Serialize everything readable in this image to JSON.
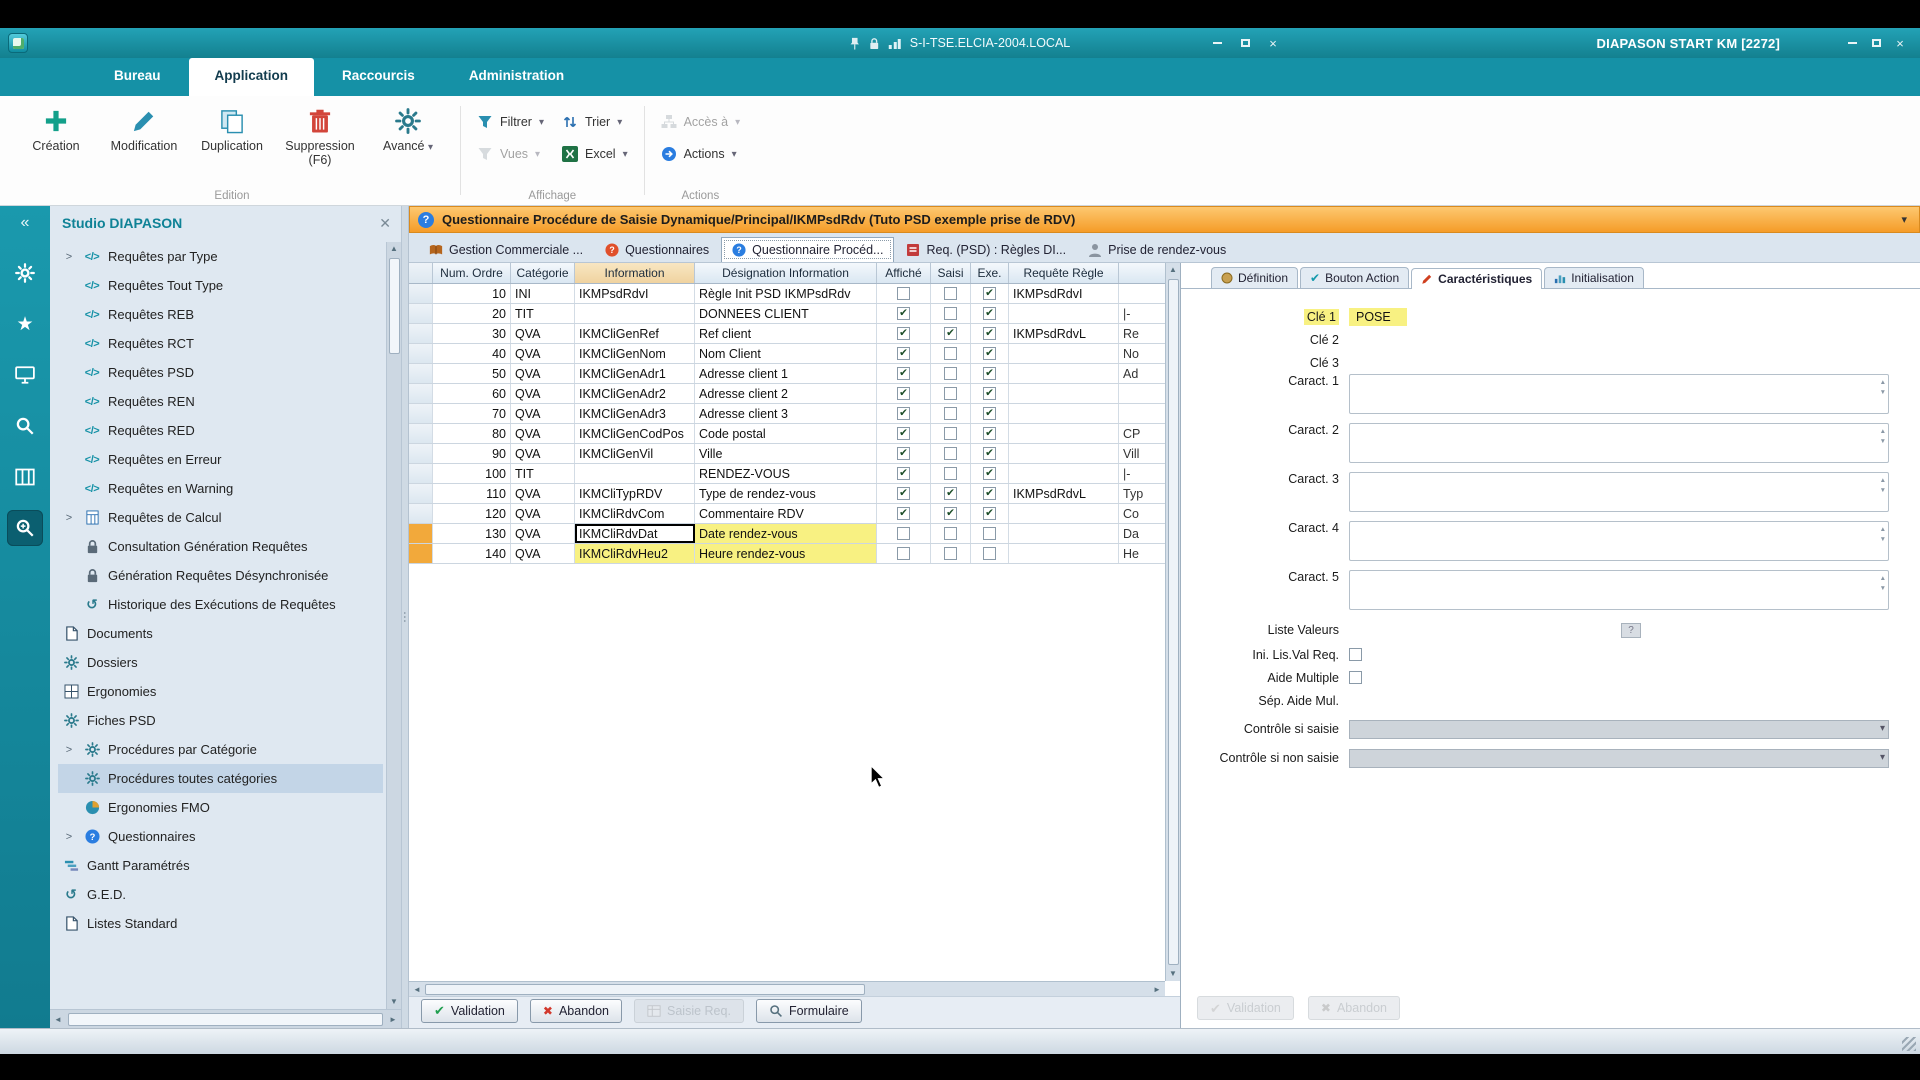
{
  "titlebar": {
    "host": "S-I-TSE.ELCIA-2004.LOCAL",
    "app_title": "DIAPASON START KM [2272]"
  },
  "ribbon": {
    "tabs": [
      {
        "label": "Bureau"
      },
      {
        "label": "Application",
        "active": true
      },
      {
        "label": "Raccourcis"
      },
      {
        "label": "Administration"
      }
    ],
    "edition_buttons": [
      {
        "label": "Création",
        "icon": "plus-icon"
      },
      {
        "label": "Modification",
        "icon": "pencil-icon"
      },
      {
        "label": "Duplication",
        "icon": "copy-icon"
      },
      {
        "label": "Suppression (F6)",
        "icon": "trash-icon"
      },
      {
        "label": "Avancé",
        "icon": "gear-icon",
        "dropdown": true
      }
    ],
    "affichage_buttons": [
      {
        "label": "Filtrer",
        "icon": "filter-icon",
        "dropdown": true
      },
      {
        "label": "Vues",
        "icon": "views-icon",
        "dropdown": true,
        "disabled": true
      },
      {
        "label": "Trier",
        "icon": "sort-icon",
        "dropdown": true
      },
      {
        "label": "Excel",
        "icon": "excel-icon",
        "dropdown": true
      }
    ],
    "actions_buttons": [
      {
        "label": "Accès à",
        "icon": "access-icon",
        "dropdown": true,
        "disabled": true
      },
      {
        "label": "Actions",
        "icon": "actions-icon",
        "dropdown": true
      }
    ],
    "group_labels": [
      "Edition",
      "Affichage",
      "Actions"
    ]
  },
  "rail": {
    "collapse": "«",
    "icons": [
      {
        "name": "gear"
      },
      {
        "name": "star"
      },
      {
        "name": "monitor"
      },
      {
        "name": "search"
      },
      {
        "name": "columns"
      },
      {
        "name": "zoom",
        "active": true
      }
    ]
  },
  "sidebar": {
    "title": "Studio DIAPASON",
    "items": [
      {
        "label": "Requêtes par Type",
        "icon": "code",
        "expand": true
      },
      {
        "label": "Requêtes Tout Type",
        "icon": "code",
        "indent": true
      },
      {
        "label": "Requêtes REB",
        "icon": "code",
        "indent": true
      },
      {
        "label": "Requêtes RCT",
        "icon": "code",
        "indent": true
      },
      {
        "label": "Requêtes PSD",
        "icon": "code",
        "indent": true
      },
      {
        "label": "Requêtes REN",
        "icon": "code",
        "indent": true
      },
      {
        "label": "Requêtes RED",
        "icon": "code",
        "indent": true
      },
      {
        "label": "Requêtes en Erreur",
        "icon": "code",
        "indent": true
      },
      {
        "label": "Requêtes en Warning",
        "icon": "code",
        "indent": true
      },
      {
        "label": "Requêtes de Calcul",
        "icon": "calc",
        "expand": true
      },
      {
        "label": "Consultation Génération Requêtes",
        "icon": "lock",
        "indent": true
      },
      {
        "label": "Génération Requêtes Désynchronisée",
        "icon": "lock",
        "indent": true
      },
      {
        "label": "Historique des Exécutions de Requêtes",
        "icon": "history",
        "indent": true
      },
      {
        "label": "Documents",
        "icon": "doc"
      },
      {
        "label": "Dossiers",
        "icon": "gear"
      },
      {
        "label": "Ergonomies",
        "icon": "grid"
      },
      {
        "label": "Fiches PSD",
        "icon": "gear"
      },
      {
        "label": "Procédures par Catégorie",
        "icon": "gear",
        "expand": true
      },
      {
        "label": "Procédures toutes catégories",
        "icon": "gear",
        "indent": true,
        "selected": true
      },
      {
        "label": "Ergonomies FMO",
        "icon": "pie",
        "indent": true
      },
      {
        "label": "Questionnaires",
        "icon": "question",
        "expand": true
      },
      {
        "label": "Gantt Paramétrés",
        "icon": "gantt"
      },
      {
        "label": "G.E.D.",
        "icon": "history"
      },
      {
        "label": "Listes Standard",
        "icon": "doc"
      }
    ]
  },
  "content": {
    "header": "Questionnaire Procédure de Saisie Dynamique/Principal/IKMPsdRdv (Tuto PSD exemple prise de RDV)",
    "doc_tabs": [
      {
        "label": "Gestion Commerciale ...",
        "icon": "book"
      },
      {
        "label": "Questionnaires",
        "icon": "q-red"
      },
      {
        "label": "Questionnaire Procéd...",
        "icon": "q-blue",
        "active": true
      },
      {
        "label": "Req. (PSD) : Règles DI...",
        "icon": "rules"
      },
      {
        "label": "Prise de rendez-vous",
        "icon": "person"
      }
    ],
    "table": {
      "columns": [
        "Num. Ordre",
        "Catégorie",
        "Information",
        "Désignation Information",
        "Affiché",
        "Saisi",
        "Exe.",
        "Requête Règle"
      ],
      "rows": [
        {
          "ordre": "10",
          "cat": "INI",
          "info": "IKMPsdRdvI",
          "des": "Règle Init PSD IKMPsdRdv",
          "affiche": false,
          "saisi": false,
          "exe": true,
          "req": "IKMPsdRdvI",
          "extra": ""
        },
        {
          "ordre": "20",
          "cat": "TIT",
          "info": "",
          "des": "DONNEES CLIENT",
          "affiche": true,
          "saisi": false,
          "exe": true,
          "req": "",
          "extra": "|-"
        },
        {
          "ordre": "30",
          "cat": "QVA",
          "info": "IKMCliGenRef",
          "des": "Ref client",
          "affiche": true,
          "saisi": true,
          "exe": true,
          "req": "IKMPsdRdvL",
          "extra": "Re"
        },
        {
          "ordre": "40",
          "cat": "QVA",
          "info": "IKMCliGenNom",
          "des": "Nom Client",
          "affiche": true,
          "saisi": false,
          "exe": true,
          "req": "",
          "extra": "No"
        },
        {
          "ordre": "50",
          "cat": "QVA",
          "info": "IKMCliGenAdr1",
          "des": "Adresse client 1",
          "affiche": true,
          "saisi": false,
          "exe": true,
          "req": "",
          "extra": "Ad"
        },
        {
          "ordre": "60",
          "cat": "QVA",
          "info": "IKMCliGenAdr2",
          "des": "Adresse client 2",
          "affiche": true,
          "saisi": false,
          "exe": true,
          "req": "",
          "extra": ""
        },
        {
          "ordre": "70",
          "cat": "QVA",
          "info": "IKMCliGenAdr3",
          "des": "Adresse client 3",
          "affiche": true,
          "saisi": false,
          "exe": true,
          "req": "",
          "extra": ""
        },
        {
          "ordre": "80",
          "cat": "QVA",
          "info": "IKMCliGenCodPos",
          "des": "Code postal",
          "affiche": true,
          "saisi": false,
          "exe": true,
          "req": "",
          "extra": "CP"
        },
        {
          "ordre": "90",
          "cat": "QVA",
          "info": "IKMCliGenVil",
          "des": "Ville",
          "affiche": true,
          "saisi": false,
          "exe": true,
          "req": "",
          "extra": "Vill"
        },
        {
          "ordre": "100",
          "cat": "TIT",
          "info": "",
          "des": "RENDEZ-VOUS",
          "affiche": true,
          "saisi": false,
          "exe": true,
          "req": "",
          "extra": "|-"
        },
        {
          "ordre": "110",
          "cat": "QVA",
          "info": "IKMCliTypRDV",
          "des": "Type de rendez-vous",
          "affiche": true,
          "saisi": true,
          "exe": true,
          "req": "IKMPsdRdvL",
          "extra": "Typ"
        },
        {
          "ordre": "120",
          "cat": "QVA",
          "info": "IKMCliRdvCom",
          "des": "Commentaire RDV",
          "affiche": true,
          "saisi": true,
          "exe": true,
          "req": "",
          "extra": "Co"
        },
        {
          "ordre": "130",
          "cat": "QVA",
          "info": "IKMCliRdvDat",
          "des": "Date rendez-vous",
          "affiche": false,
          "saisi": false,
          "exe": false,
          "req": "",
          "extra": "Da",
          "highlight": true,
          "focus": true
        },
        {
          "ordre": "140",
          "cat": "QVA",
          "info": "IKMCliRdvHeu2",
          "des": "Heure rendez-vous",
          "affiche": false,
          "saisi": false,
          "exe": false,
          "req": "",
          "extra": "He",
          "highlight": true
        }
      ]
    },
    "footer_buttons": [
      {
        "label": "Validation",
        "icon": "check-icon"
      },
      {
        "label": "Abandon",
        "icon": "cross-icon"
      },
      {
        "label": "Saisie Req.",
        "icon": "saisie-icon",
        "disabled": true
      },
      {
        "label": "Formulaire",
        "icon": "magnifier-icon"
      }
    ]
  },
  "detail": {
    "tabs": [
      {
        "label": "Définition",
        "icon": "def-icon"
      },
      {
        "label": "Bouton Action",
        "icon": "check-teal-icon"
      },
      {
        "label": "Caractéristiques",
        "icon": "pencil-red-icon",
        "active": true
      },
      {
        "label": "Initialisation",
        "icon": "chart-icon"
      }
    ],
    "cle1_label": "Clé 1",
    "cle1_value": "POSE",
    "cle2_label": "Clé 2",
    "cle3_label": "Clé 3",
    "caract_labels": [
      "Caract. 1",
      "Caract. 2",
      "Caract. 3",
      "Caract. 4",
      "Caract. 5"
    ],
    "liste_valeurs_label": "Liste Valeurs",
    "ini_lisval_label": "Ini. Lis.Val Req.",
    "aide_multiple_label": "Aide Multiple",
    "sep_aide_label": "Sép. Aide Mul.",
    "controle_saisie_label": "Contrôle si saisie",
    "controle_non_saisie_label": "Contrôle si non saisie",
    "footer_buttons": [
      {
        "label": "Validation",
        "icon": "check-icon",
        "disabled": true
      },
      {
        "label": "Abandon",
        "icon": "cross-icon",
        "disabled": true
      }
    ]
  }
}
